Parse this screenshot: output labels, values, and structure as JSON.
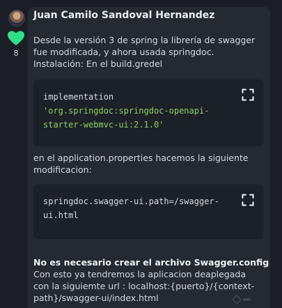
{
  "comment": {
    "author": "Juan Camilo Sandoval Hernandez",
    "likes": "8",
    "intro_lines": [
      "Desde la versión 3 de spring la librería de swagger",
      "fue modificada, y ahora usada springdoc.",
      "Instalación: En el build.gredel"
    ],
    "code_block_1": {
      "keyword": "implementation",
      "string_lines": [
        "'org.springdoc:springdoc-openapi-",
        "starter-webmvc-ui:2.1.0'"
      ]
    },
    "middle_lines": [
      "en el application.properties hacemos la siguiente",
      "modificacion:"
    ],
    "code_block_2": {
      "lines": [
        "springdoc.swagger-ui.path=/swagger-",
        "ui.html"
      ]
    },
    "outro_bold": "No es necesario crear el archivo Swagger.config",
    "outro_lines": [
      "Con esto ya tendremos la aplicacion deaplegada",
      "con la siguiemte url : localhost:{puerto}/{context-",
      "path}/swagger-ui/index.html"
    ]
  },
  "icons": {
    "avatar": "user-avatar",
    "like": "heart-icon",
    "expand": "expand-icon"
  },
  "colors": {
    "background": "#1b1f25",
    "card": "#242932",
    "code_background": "#1c2027",
    "heart": "#2fe08a",
    "code_string": "#8ed067"
  }
}
